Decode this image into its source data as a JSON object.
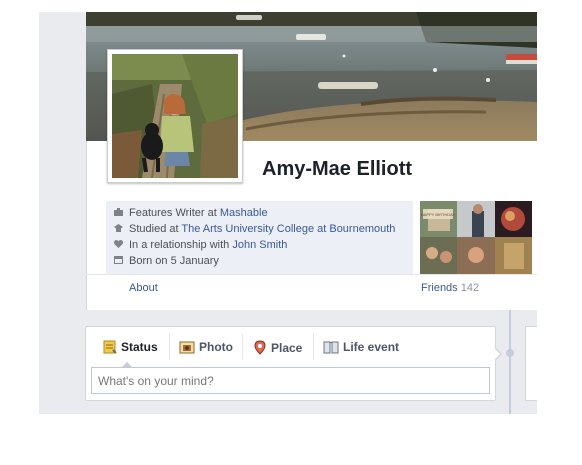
{
  "profile": {
    "name": "Amy-Mae Elliott"
  },
  "info": {
    "work_prefix": "Features Writer at ",
    "work_link": "Mashable",
    "study_prefix": "Studied at ",
    "study_link": "The Arts University College at Bournemouth",
    "relationship_prefix": "In a relationship with ",
    "relationship_link": "John Smith",
    "birthday": "Born on 5 January"
  },
  "nav": {
    "about": "About",
    "friends": "Friends",
    "friends_count": "142"
  },
  "composer": {
    "tabs": [
      {
        "label": "Status",
        "icon": "status-icon"
      },
      {
        "label": "Photo",
        "icon": "photo-icon"
      },
      {
        "label": "Place",
        "icon": "place-icon"
      },
      {
        "label": "Life event",
        "icon": "life-event-icon"
      }
    ],
    "placeholder": "What's on your mind?"
  },
  "colors": {
    "link": "#3b5998",
    "background": "#e9ebee",
    "info_box": "#eceff5"
  },
  "friends_mosaic_thumb_text": "HAPPY BIRTHDAY"
}
